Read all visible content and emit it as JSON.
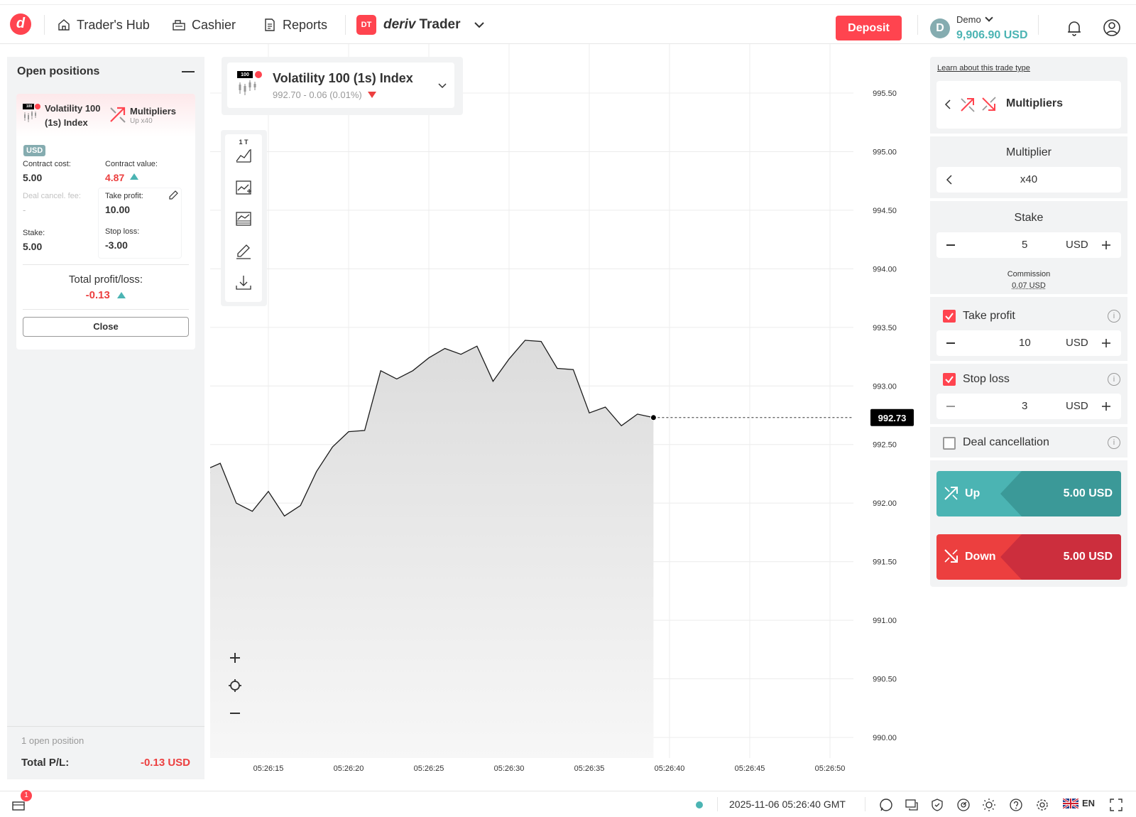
{
  "header": {
    "logo_letter": "d",
    "nav": {
      "traders_hub": "Trader's Hub",
      "cashier": "Cashier",
      "reports": "Reports"
    },
    "app_badge": "DT",
    "app_brand": "deriv",
    "app_name": "Trader",
    "deposit_label": "Deposit",
    "account": {
      "currency_letter": "D",
      "type": "Demo",
      "balance": "9,906.90 USD"
    }
  },
  "open_positions": {
    "title": "Open positions",
    "card": {
      "market_badge": "100",
      "market_name_line1": "Volatility 100",
      "market_name_line2": "(1s) Index",
      "trade_type": "Multipliers",
      "trade_sub": "Up x40",
      "currency_tag": "USD",
      "contract_cost_label": "Contract cost:",
      "contract_cost": "5.00",
      "contract_value_label": "Contract value:",
      "contract_value": "4.87",
      "deal_cancel_label": "Deal cancel. fee:",
      "deal_cancel_value": "-",
      "take_profit_label": "Take profit:",
      "take_profit_value": "10.00",
      "stake_label": "Stake:",
      "stake_value": "5.00",
      "stop_loss_label": "Stop loss:",
      "stop_loss_value": "-3.00",
      "total_pl_label": "Total profit/loss:",
      "total_pl_value": "-0.13",
      "close_label": "Close"
    },
    "footer": {
      "count_text": "1 open position",
      "total_label": "Total P/L:",
      "total_value": "-0.13 USD"
    }
  },
  "market": {
    "name": "Volatility 100 (1s) Index",
    "quote": "992.70 - 0.06 (0.01%)",
    "badge": "100",
    "toolbar_interval": "1 T"
  },
  "chart_data": {
    "type": "area",
    "current_price": "992.73",
    "ylim": [
      990.0,
      995.5
    ],
    "y_ticks": [
      "995.50",
      "995.00",
      "994.50",
      "994.00",
      "993.50",
      "993.00",
      "992.50",
      "992.00",
      "991.50",
      "991.00",
      "990.50",
      "990.00"
    ],
    "x_ticks": [
      "05:26:15",
      "05:26:20",
      "05:26:25",
      "05:26:30",
      "05:26:35",
      "05:26:40",
      "05:26:45",
      "05:26:50"
    ],
    "tick_start_seconds": 11.0,
    "tick_interval_seconds": 1.0,
    "values": [
      992.28,
      992.34,
      992.0,
      991.93,
      992.1,
      991.89,
      991.98,
      992.27,
      992.48,
      992.61,
      992.62,
      993.13,
      993.06,
      993.13,
      993.24,
      993.32,
      993.27,
      993.34,
      993.04,
      993.23,
      993.39,
      993.38,
      993.15,
      993.14,
      992.77,
      992.82,
      992.66,
      992.76,
      992.73
    ]
  },
  "trade": {
    "learn_link": "Learn about this trade type",
    "trade_type": "Multipliers",
    "multiplier_label": "Multiplier",
    "multiplier_value": "x40",
    "stake_label": "Stake",
    "stake_value": "5",
    "currency": "USD",
    "commission_label": "Commission",
    "commission_value": "0.07 USD",
    "take_profit_label": "Take profit",
    "take_profit_value": "10",
    "stop_loss_label": "Stop loss",
    "stop_loss_value": "3",
    "deal_cancel_label": "Deal cancellation",
    "up_label": "Up",
    "up_amount": "5.00 USD",
    "down_label": "Down",
    "down_amount": "5.00 USD"
  },
  "footer": {
    "notification_count": "1",
    "datetime": "2025-11-06 05:26:40 GMT",
    "language": "EN"
  },
  "colors": {
    "brand_red": "#ff444f",
    "teal": "#4bb4b3",
    "loss_red": "#ec3f3f"
  }
}
